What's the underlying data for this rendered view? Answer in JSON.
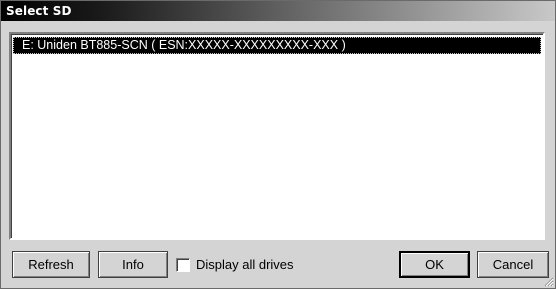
{
  "window": {
    "title": "Select SD"
  },
  "list": {
    "items": [
      {
        "label": "E: Uniden BT885-SCN  ( ESN:XXXXX-XXXXXXXXX-XXX )",
        "selected": true
      }
    ]
  },
  "buttons": {
    "refresh": "Refresh",
    "info": "Info",
    "ok": "OK",
    "cancel": "Cancel"
  },
  "options": {
    "display_all_drives": {
      "label": "Display all drives",
      "checked": false
    }
  },
  "colors": {
    "face": "#d4d4d4",
    "selection_bg": "#000000",
    "selection_fg": "#ffffff"
  }
}
